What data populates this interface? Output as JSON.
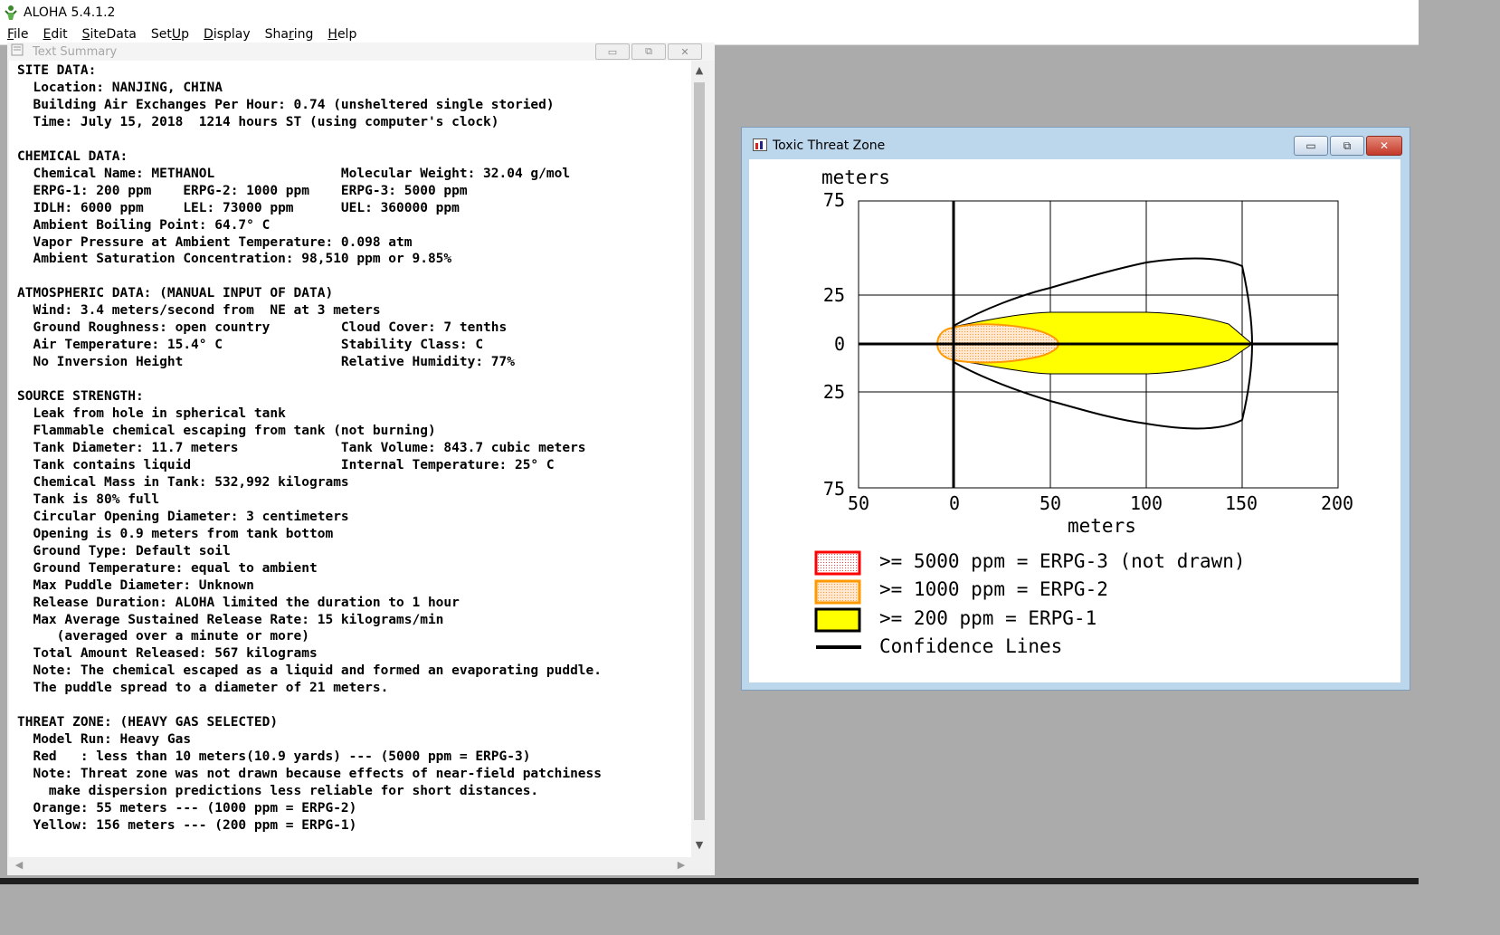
{
  "app": {
    "title": "ALOHA 5.4.1.2",
    "menu": [
      {
        "pre": "",
        "u": "F",
        "post": "ile"
      },
      {
        "pre": "",
        "u": "E",
        "post": "dit"
      },
      {
        "pre": "",
        "u": "S",
        "post": "iteData"
      },
      {
        "pre": "Set",
        "u": "U",
        "post": "p"
      },
      {
        "pre": "",
        "u": "D",
        "post": "isplay"
      },
      {
        "pre": "Sha",
        "u": "r",
        "post": "ing"
      },
      {
        "pre": "",
        "u": "H",
        "post": "elp"
      }
    ]
  },
  "text_summary": {
    "title": "Text Summary",
    "lines": [
      "SITE DATA:",
      "  Location: NANJING, CHINA",
      "  Building Air Exchanges Per Hour: 0.74 (unsheltered single storied)",
      "  Time: July 15, 2018  1214 hours ST (using computer's clock)",
      "",
      "CHEMICAL DATA:",
      "  Chemical Name: METHANOL                Molecular Weight: 32.04 g/mol",
      "  ERPG-1: 200 ppm    ERPG-2: 1000 ppm    ERPG-3: 5000 ppm",
      "  IDLH: 6000 ppm     LEL: 73000 ppm      UEL: 360000 ppm",
      "  Ambient Boiling Point: 64.7° C",
      "  Vapor Pressure at Ambient Temperature: 0.098 atm",
      "  Ambient Saturation Concentration: 98,510 ppm or 9.85%",
      "",
      "ATMOSPHERIC DATA: (MANUAL INPUT OF DATA)",
      "  Wind: 3.4 meters/second from  NE at 3 meters",
      "  Ground Roughness: open country         Cloud Cover: 7 tenths",
      "  Air Temperature: 15.4° C               Stability Class: C",
      "  No Inversion Height                    Relative Humidity: 77%",
      "",
      "SOURCE STRENGTH:",
      "  Leak from hole in spherical tank",
      "  Flammable chemical escaping from tank (not burning)",
      "  Tank Diameter: 11.7 meters             Tank Volume: 843.7 cubic meters",
      "  Tank contains liquid                   Internal Temperature: 25° C",
      "  Chemical Mass in Tank: 532,992 kilograms",
      "  Tank is 80% full",
      "  Circular Opening Diameter: 3 centimeters",
      "  Opening is 0.9 meters from tank bottom",
      "  Ground Type: Default soil",
      "  Ground Temperature: equal to ambient",
      "  Max Puddle Diameter: Unknown",
      "  Release Duration: ALOHA limited the duration to 1 hour",
      "  Max Average Sustained Release Rate: 15 kilograms/min",
      "     (averaged over a minute or more)",
      "  Total Amount Released: 567 kilograms",
      "  Note: The chemical escaped as a liquid and formed an evaporating puddle.",
      "  The puddle spread to a diameter of 21 meters.",
      "",
      "THREAT ZONE: (HEAVY GAS SELECTED)",
      "  Model Run: Heavy Gas",
      "  Red   : less than 10 meters(10.9 yards) --- (5000 ppm = ERPG-3)",
      "  Note: Threat zone was not drawn because effects of near-field patchiness",
      "    make dispersion predictions less reliable for short distances.",
      "  Orange: 55 meters --- (1000 ppm = ERPG-2)",
      "  Yellow: 156 meters --- (200 ppm = ERPG-1)"
    ]
  },
  "threat_zone": {
    "title": "Toxic Threat Zone",
    "y_unit": "meters",
    "x_unit": "meters",
    "y_ticks": [
      "75",
      "25",
      "0",
      "25",
      "75"
    ],
    "x_ticks": [
      "50",
      "0",
      "50",
      "100",
      "150",
      "200"
    ],
    "legend": [
      {
        "label": ">= 5000 ppm = ERPG-3 (not drawn)",
        "color": "#ff0000",
        "fill": "#ffe6e6"
      },
      {
        "label": ">= 1000 ppm = ERPG-2",
        "color": "#ff9900",
        "fill": "#ffd9a8"
      },
      {
        "label": ">= 200 ppm = ERPG-1",
        "color": "#000000",
        "fill": "#ffff00"
      },
      {
        "label": "Confidence Lines",
        "color": "#000000",
        "fill": "none"
      }
    ]
  }
}
